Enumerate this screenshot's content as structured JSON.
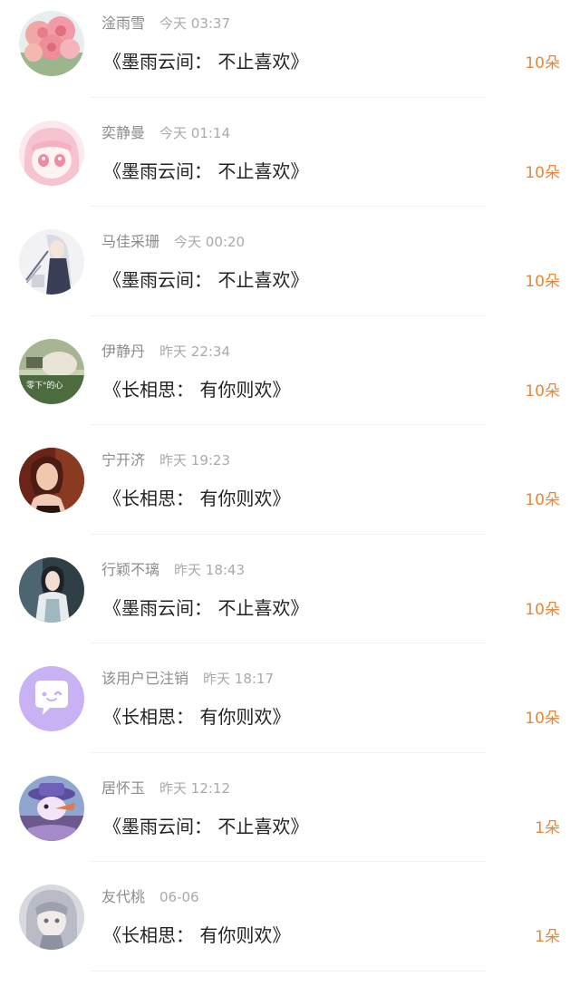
{
  "gifts": [
    {
      "user": "淦雨雪",
      "time": "今天 03:37",
      "book": "《墨雨云间： 不止喜欢》",
      "count": "10朵",
      "avatar": "flowers"
    },
    {
      "user": "奕静曼",
      "time": "今天 01:14",
      "book": "《墨雨云间： 不止喜欢》",
      "count": "10朵",
      "avatar": "anime-pink"
    },
    {
      "user": "马佳采珊",
      "time": "今天 00:20",
      "book": "《墨雨云间： 不止喜欢》",
      "count": "10朵",
      "avatar": "anime-white-hair"
    },
    {
      "user": "伊静丹",
      "time": "昨天 22:34",
      "book": "《长相思： 有你则欢》",
      "count": "10朵",
      "avatar": "photo-green",
      "avatar_caption": "零下°的心"
    },
    {
      "user": "宁开济",
      "time": "昨天 19:23",
      "book": "《长相思： 有你则欢》",
      "count": "10朵",
      "avatar": "woman-photo"
    },
    {
      "user": "行颖不璃",
      "time": "昨天 18:43",
      "book": "《墨雨云间： 不止喜欢》",
      "count": "10朵",
      "avatar": "woman-drama"
    },
    {
      "user": "该用户已注销",
      "time": "昨天 18:17",
      "book": "《长相思： 有你则欢》",
      "count": "10朵",
      "avatar": "default-chat"
    },
    {
      "user": "居怀玉",
      "time": "昨天 12:12",
      "book": "《墨雨云间： 不止喜欢》",
      "count": "1朵",
      "avatar": "cartoon-hat"
    },
    {
      "user": "友代桃",
      "time": "06-06",
      "book": "《长相思： 有你则欢》",
      "count": "1朵",
      "avatar": "anime-gray"
    }
  ],
  "colors": {
    "count": "#e8873a",
    "username": "#8c8c8c",
    "timestamp": "#aaaaaa",
    "book": "#222222"
  }
}
